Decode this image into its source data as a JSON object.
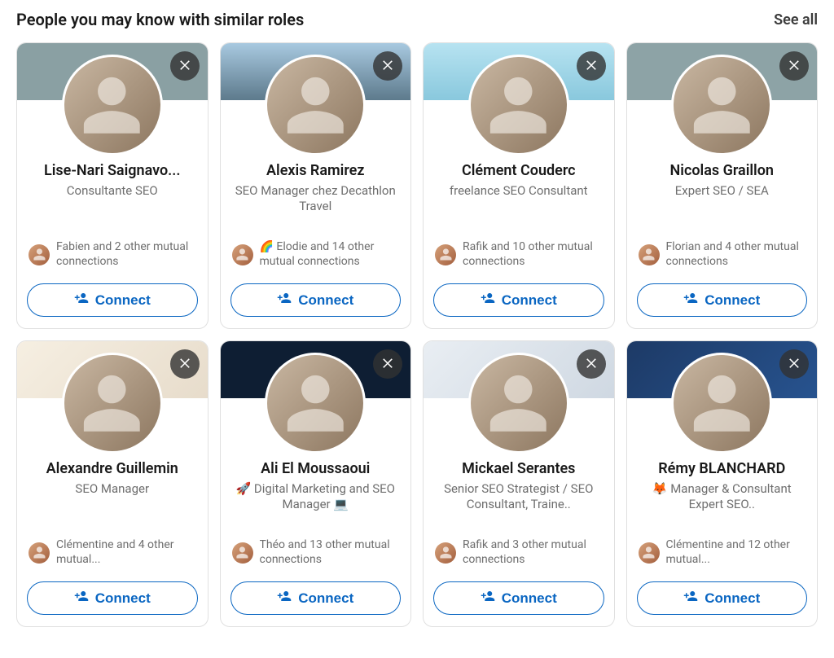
{
  "header": {
    "title": "People you may know with similar roles",
    "see_all": "See all"
  },
  "connect_label": "Connect",
  "people": [
    {
      "name": "Lise-Nari Saignavo...",
      "title": "Consultante SEO",
      "mutual": "Fabien and 2 other mutual connections",
      "cover_class": "c1"
    },
    {
      "name": "Alexis Ramirez",
      "title": "SEO Manager chez Decathlon Travel",
      "mutual": "🌈 Elodie and 14 other mutual connections",
      "cover_class": "c2"
    },
    {
      "name": "Clément Couderc",
      "title": "freelance SEO Consultant",
      "mutual": "Rafik and 10 other mutual connections",
      "cover_class": "c3"
    },
    {
      "name": "Nicolas Graillon",
      "title": "Expert SEO / SEA",
      "mutual": "Florian and 4 other mutual connections",
      "cover_class": "c4"
    },
    {
      "name": "Alexandre Guillemin",
      "title": "SEO Manager",
      "mutual": "Clémentine and 4 other mutual...",
      "cover_class": "c5"
    },
    {
      "name": "Ali El Moussaoui",
      "title": "🚀 Digital Marketing and SEO Manager 💻",
      "mutual": "Théo and 13 other mutual connections",
      "cover_class": "c6"
    },
    {
      "name": "Mickael Serantes",
      "title": "Senior SEO Strategist / SEO Consultant, Traine..",
      "mutual": "Rafik and 3 other mutual connections",
      "cover_class": "c7"
    },
    {
      "name": "Rémy BLANCHARD",
      "title": "🦊 Manager & Consultant Expert SEO..",
      "mutual": "Clémentine and 12 other mutual...",
      "cover_class": "c8"
    }
  ]
}
